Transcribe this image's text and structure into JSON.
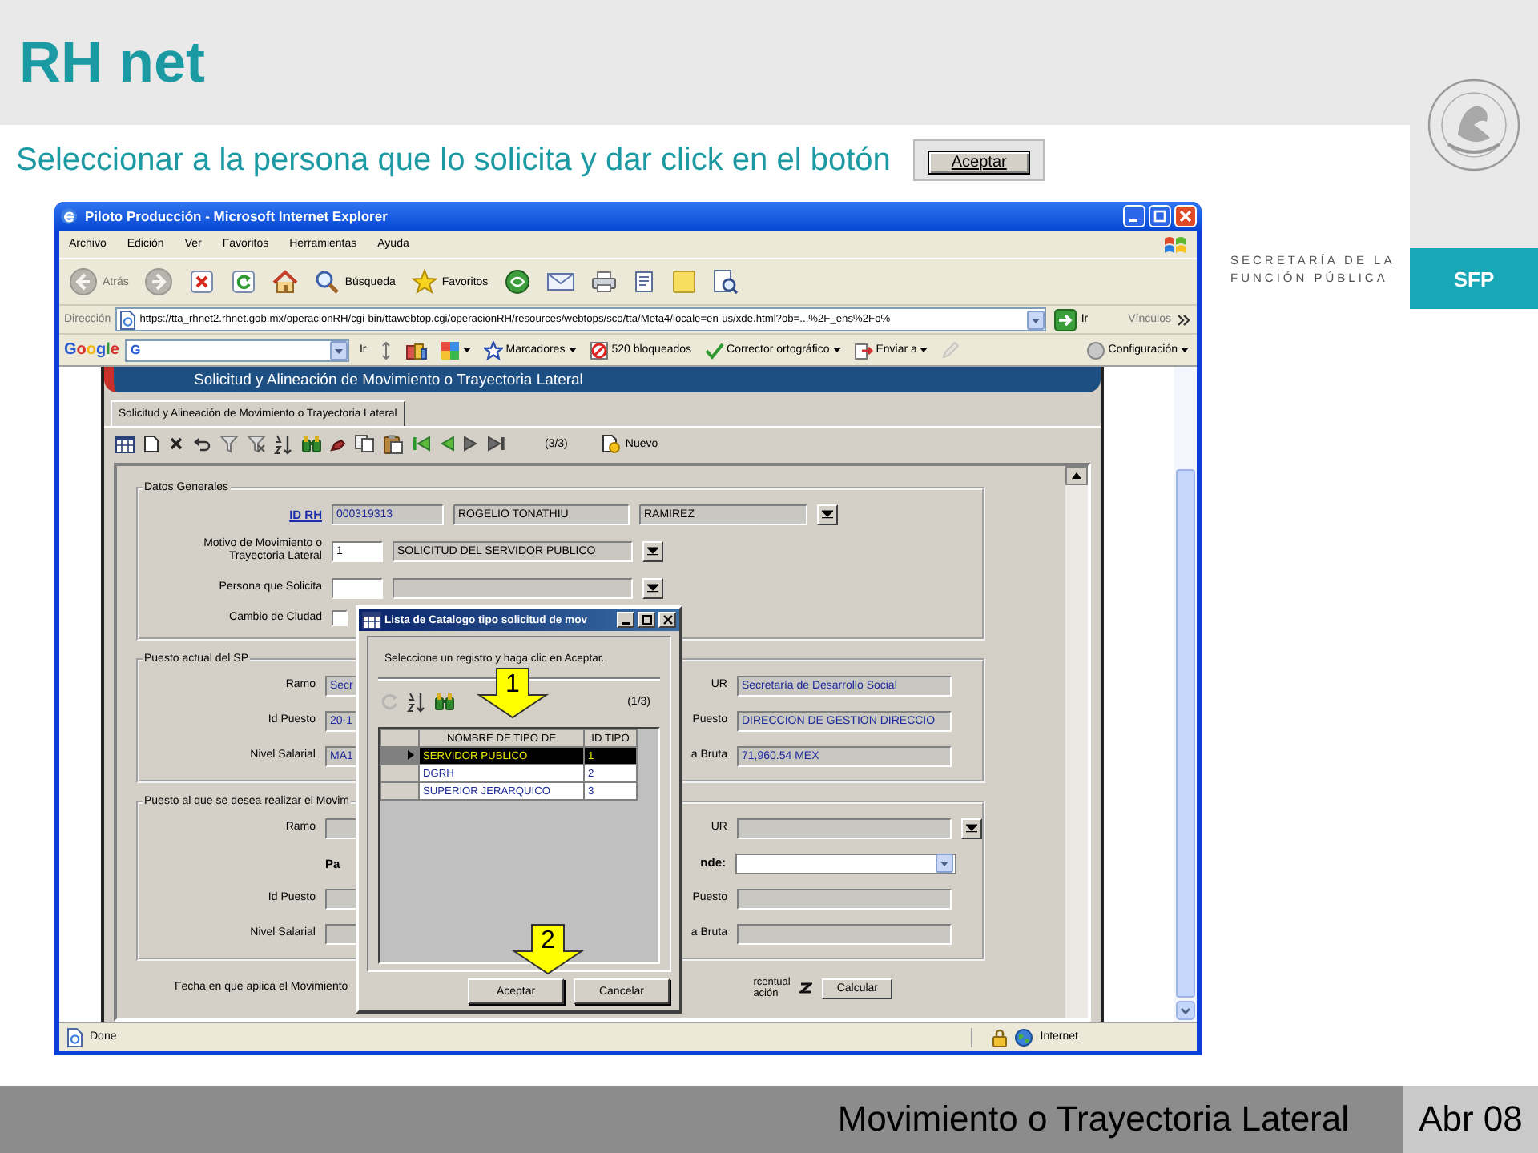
{
  "slide": {
    "title": "RH net",
    "instruction": "Seleccionar a la persona que lo solicita y dar click en el botón",
    "sample_button": "Aceptar",
    "org_lines": [
      "SECRETARÍA DE LA",
      "FUNCIÓN PÚBLICA"
    ],
    "org_badge": "SFP",
    "footer_title": "Movimiento o Trayectoria Lateral",
    "footer_date": "Abr 08"
  },
  "browser": {
    "title": "Piloto Producción - Microsoft Internet Explorer",
    "menu": [
      "Archivo",
      "Edición",
      "Ver",
      "Favoritos",
      "Herramientas",
      "Ayuda"
    ],
    "toolbar": [
      {
        "kind": "back",
        "label": "Atrás",
        "disabled": true
      },
      {
        "kind": "forward",
        "disabled": true
      },
      {
        "kind": "stop",
        "disabled": false
      },
      {
        "kind": "refresh",
        "disabled": false
      },
      {
        "kind": "home",
        "disabled": false
      },
      {
        "kind": "search",
        "label": "Búsqueda",
        "disabled": false
      },
      {
        "kind": "favorites",
        "label": "Favoritos",
        "disabled": false
      },
      {
        "kind": "media",
        "disabled": false
      },
      {
        "kind": "mail",
        "disabled": false
      },
      {
        "kind": "print",
        "disabled": false
      },
      {
        "kind": "edit",
        "disabled": false
      },
      {
        "kind": "notes",
        "disabled": false
      },
      {
        "kind": "research",
        "disabled": false
      }
    ],
    "address_label": "Dirección",
    "url": "https://tta_rhnet2.rhnet.gob.mx/operacionRH/cgi-bin/ttawebtop.cgi/operacionRH/resources/webtops/sco/tta/Meta4/locale=en-us/xde.html?ob=...%2F_ens%2Fo%",
    "go_label": "Ir",
    "links_label": "Vínculos",
    "google": {
      "logo": "Google",
      "search_prefix": "G",
      "go_label": "Ir",
      "items": [
        {
          "kind": "updown",
          "menu": false,
          "disabled": false
        },
        {
          "kind": "books",
          "menu": false,
          "disabled": false
        },
        {
          "kind": "colors",
          "menu": true,
          "disabled": false
        },
        {
          "kind": "bookmarks",
          "label": "Marcadores",
          "menu": true,
          "disabled": false
        },
        {
          "kind": "blocked",
          "label": "520 bloqueados",
          "menu": false,
          "disabled": false
        },
        {
          "kind": "spell",
          "label": "Corrector ortográfico",
          "menu": true,
          "disabled": false
        },
        {
          "kind": "send",
          "label": "Enviar a",
          "menu": true,
          "disabled": false
        },
        {
          "kind": "pencil",
          "menu": false,
          "disabled": true
        }
      ],
      "settings_label": "Configuración"
    },
    "status": "Done",
    "zone": "Internet"
  },
  "app": {
    "banner": "Solicitud y Alineación de Movimiento o Trayectoria Lateral",
    "tabs": [
      {
        "label": "Solicitud y Alineación de Movimiento o Trayectoria Lateral",
        "selected": true
      }
    ],
    "tools": [
      {
        "kind": "grid"
      },
      {
        "kind": "newdoc"
      },
      {
        "kind": "delete"
      },
      {
        "kind": "undo"
      },
      {
        "kind": "filter"
      },
      {
        "kind": "filterx"
      },
      {
        "kind": "sort"
      },
      {
        "kind": "binoc"
      },
      {
        "kind": "marker"
      },
      {
        "kind": "copy"
      },
      {
        "kind": "paste"
      },
      {
        "kind": "first"
      },
      {
        "kind": "prev"
      },
      {
        "kind": "next"
      },
      {
        "kind": "last"
      }
    ],
    "record_count": "(3/3)",
    "new_label": "Nuevo",
    "general": {
      "legend": "Datos Generales",
      "id_label": "ID RH",
      "id_values": [
        "000319313",
        "ROGELIO TONATHIU",
        "RAMIREZ"
      ],
      "motivo_lines": [
        "Motivo  de Movimiento o",
        "Trayectoria Lateral"
      ],
      "motivo_code": "1",
      "motivo_value": "SOLICITUD DEL SERVIDOR PUBLICO",
      "persona_label": "Persona que Solicita",
      "cambio_label": "Cambio de Ciudad",
      "cambio_checked": false
    },
    "current": {
      "legend": "Puesto actual del SP",
      "rows": [
        {
          "kind": "pair",
          "label": "Ramo",
          "value": "Secr",
          "right_label": "UR",
          "right_value": "Secretaría de Desarrollo Social",
          "dropdown": false
        },
        {
          "kind": "pair",
          "label": "Id Puesto",
          "value": "20-1",
          "right_label": "Puesto",
          "right_value": "DIRECCION DE GESTION DIRECCIO",
          "dropdown": false
        },
        {
          "kind": "pair",
          "label": "Nivel Salarial",
          "value": "MA1",
          "right_label": "a Bruta",
          "right_value": "71,960.54 MEX",
          "dropdown": false
        }
      ]
    },
    "target": {
      "legend": "Puesto al que se desea realizar el Movim",
      "rows": [
        {
          "kind": "pair",
          "label": "Ramo",
          "right_label": "UR",
          "dropdown": true
        },
        {
          "kind": "choice",
          "label": "Pa",
          "right_label": "nde:"
        },
        {
          "kind": "pair",
          "label": "Id Puesto",
          "right_label": "Puesto",
          "dropdown": false
        },
        {
          "kind": "pair",
          "label": "Nivel Salarial",
          "right_label": "a Bruta",
          "dropdown": false
        }
      ]
    },
    "bottom": {
      "fecha_label": "Fecha en que aplica el Movimiento",
      "percent_lines": [
        "rcentual",
        "ación"
      ],
      "calc_label": "Calcular"
    }
  },
  "dialog": {
    "title": "Lista de Catalogo tipo solicitud de mov",
    "instruction": "Seleccione un registro y haga clic en Aceptar.",
    "tools": [
      {
        "kind": "cycle",
        "disabled": true
      },
      {
        "kind": "sort",
        "disabled": false
      },
      {
        "kind": "binoc",
        "disabled": false
      }
    ],
    "record_count": "(1/3)",
    "columns": [
      "NOMBRE DE TIPO DE",
      "ID TIPO"
    ],
    "rows": [
      {
        "name": "SERVIDOR PUBLICO",
        "id": "1",
        "selected": true
      },
      {
        "name": "DGRH",
        "id": "2",
        "selected": false
      },
      {
        "name": "SUPERIOR JERARQUICO",
        "id": "3",
        "selected": false
      }
    ],
    "buttons": [
      "Aceptar",
      "Cancelar"
    ]
  },
  "callouts": [
    "1",
    "2"
  ]
}
